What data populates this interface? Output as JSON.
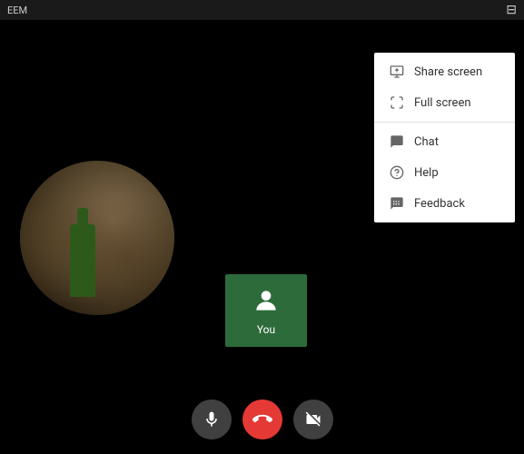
{
  "titleBar": {
    "title": "EEM",
    "icon": "⊟"
  },
  "youTile": {
    "label": "You"
  },
  "contextMenu": {
    "items": [
      {
        "id": "share-screen",
        "label": "Share screen",
        "icon": "share"
      },
      {
        "id": "full-screen",
        "label": "Full screen",
        "icon": "fullscreen"
      },
      {
        "id": "chat",
        "label": "Chat",
        "icon": "chat"
      },
      {
        "id": "help",
        "label": "Help",
        "icon": "help"
      },
      {
        "id": "feedback",
        "label": "Feedback",
        "icon": "feedback"
      }
    ]
  },
  "controls": {
    "mic": "🎤",
    "endCall": "📞",
    "videoOff": "🎥"
  }
}
